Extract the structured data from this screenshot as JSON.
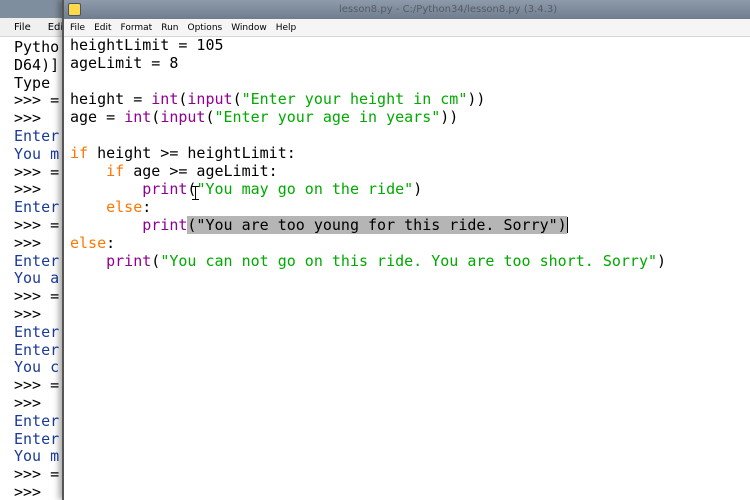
{
  "shell": {
    "menu": [
      "File",
      "Edit"
    ],
    "lines": [
      {
        "text": "Pytho",
        "color": "blk"
      },
      {
        "text": "D64)]",
        "color": "blk"
      },
      {
        "text": "Type",
        "color": "blk"
      },
      {
        "text": ">>> =",
        "color": "blk"
      },
      {
        "text": ">>>",
        "color": "blk"
      },
      {
        "text": "Enter",
        "color": "blu"
      },
      {
        "text": "You m",
        "color": "blu"
      },
      {
        "text": ">>> =",
        "color": "blk"
      },
      {
        "text": ">>>",
        "color": "blk"
      },
      {
        "text": "Enter",
        "color": "blu"
      },
      {
        "text": ">>> =",
        "color": "blk"
      },
      {
        "text": ">>>",
        "color": "blk"
      },
      {
        "text": "Enter",
        "color": "blu"
      },
      {
        "text": "You a",
        "color": "blu"
      },
      {
        "text": ">>> =",
        "color": "blk"
      },
      {
        "text": ">>>",
        "color": "blk"
      },
      {
        "text": "Enter",
        "color": "blu"
      },
      {
        "text": "Enter",
        "color": "blu"
      },
      {
        "text": "You c",
        "color": "blu"
      },
      {
        "text": ">>> =",
        "color": "blk"
      },
      {
        "text": ">>>",
        "color": "blk"
      },
      {
        "text": "Enter",
        "color": "blu"
      },
      {
        "text": "Enter",
        "color": "blu"
      },
      {
        "text": "You m",
        "color": "blu"
      },
      {
        "text": ">>> =",
        "color": "blk"
      },
      {
        "text": ">>>",
        "color": "blk"
      }
    ]
  },
  "editor": {
    "title": "lesson8.py - C:/Python34/lesson8.py (3.4.3)",
    "menu": [
      "File",
      "Edit",
      "Format",
      "Run",
      "Options",
      "Window",
      "Help"
    ],
    "code": [
      [
        {
          "t": "heightLimit = 105",
          "c": "pl"
        }
      ],
      [
        {
          "t": "ageLimit = 8",
          "c": "pl"
        }
      ],
      [],
      [
        {
          "t": "height = ",
          "c": "pl"
        },
        {
          "t": "int",
          "c": "bi"
        },
        {
          "t": "(",
          "c": "pl"
        },
        {
          "t": "input",
          "c": "bi"
        },
        {
          "t": "(",
          "c": "pl"
        },
        {
          "t": "\"Enter your height in cm\"",
          "c": "str"
        },
        {
          "t": "))",
          "c": "pl"
        }
      ],
      [
        {
          "t": "age = ",
          "c": "pl"
        },
        {
          "t": "int",
          "c": "bi"
        },
        {
          "t": "(",
          "c": "pl"
        },
        {
          "t": "input",
          "c": "bi"
        },
        {
          "t": "(",
          "c": "pl"
        },
        {
          "t": "\"Enter your age in years\"",
          "c": "str"
        },
        {
          "t": "))",
          "c": "pl"
        }
      ],
      [],
      [
        {
          "t": "if",
          "c": "kw"
        },
        {
          "t": " height >= heightLimit:",
          "c": "pl"
        }
      ],
      [
        {
          "t": "    ",
          "c": "pl"
        },
        {
          "t": "if",
          "c": "kw"
        },
        {
          "t": " age >= ageLimit:",
          "c": "pl"
        }
      ],
      [
        {
          "t": "        ",
          "c": "pl"
        },
        {
          "t": "print",
          "c": "bi"
        },
        {
          "t": "(",
          "c": "pl"
        },
        {
          "t": "\"You may go on the ride\"",
          "c": "str"
        },
        {
          "t": ")",
          "c": "pl"
        }
      ],
      [
        {
          "t": "    ",
          "c": "pl"
        },
        {
          "t": "else",
          "c": "kw"
        },
        {
          "t": ":",
          "c": "pl"
        }
      ],
      [
        {
          "t": "        ",
          "c": "pl"
        },
        {
          "t": "print",
          "c": "bi"
        },
        {
          "t": "(\"You are too young for this ride. Sorry\")",
          "c": "pl sel"
        },
        {
          "t": "|",
          "c": "cursor"
        }
      ],
      [
        {
          "t": "else",
          "c": "kw"
        },
        {
          "t": ":",
          "c": "pl"
        }
      ],
      [
        {
          "t": "    ",
          "c": "pl"
        },
        {
          "t": "print",
          "c": "bi"
        },
        {
          "t": "(",
          "c": "pl"
        },
        {
          "t": "\"You can not go on this ride. You are too short. Sorry\"",
          "c": "str"
        },
        {
          "t": ")",
          "c": "pl"
        }
      ]
    ]
  },
  "colors": {
    "keyword": "#ff7700",
    "builtin": "#900090",
    "string": "#00aa00",
    "selection": "#b5b5b5",
    "shell_output": "#1a3a9a"
  }
}
